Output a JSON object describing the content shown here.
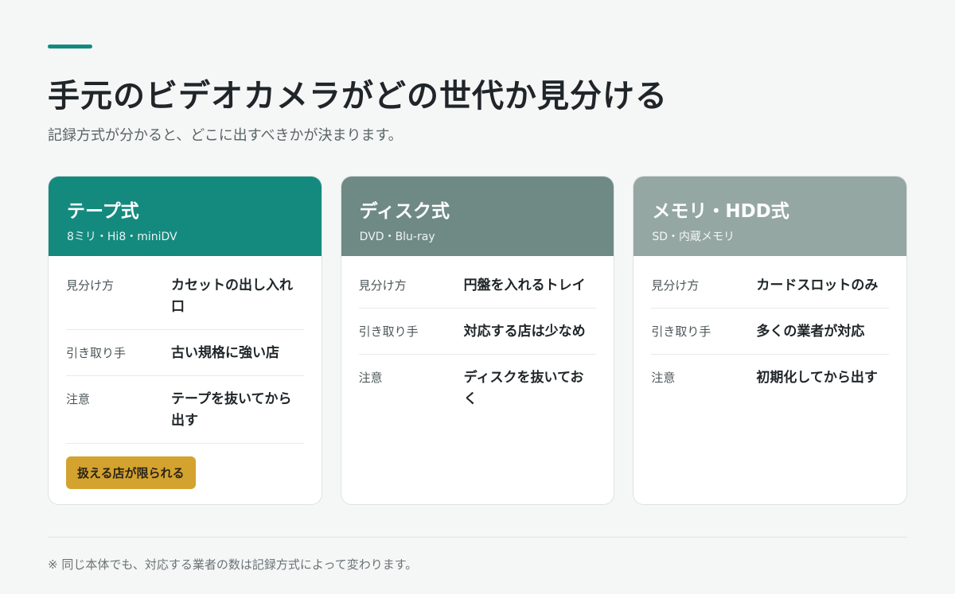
{
  "page": {
    "title": "手元のビデオカメラがどの世代か見分ける",
    "subtitle": "記録方式が分かると、どこに出すべきかが決まります。",
    "footnote": "※ 同じ本体でも、対応する業者の数は記録方式によって変わります。"
  },
  "colors": {
    "accent": "#148a7f",
    "tape_header": "#148a7f",
    "disc_header": "#6f8a85",
    "memory_header": "#95a7a3",
    "badge": "#d4a22e"
  },
  "cards": [
    {
      "title": "テープ式",
      "subtitle": "8ミリ・Hi8・miniDV",
      "rows": [
        {
          "label": "見分け方",
          "value": "カセットの出し入れ口"
        },
        {
          "label": "引き取り手",
          "value": "古い規格に強い店"
        },
        {
          "label": "注意",
          "value": "テープを抜いてから出す"
        }
      ],
      "badge": "扱える店が限られる"
    },
    {
      "title": "ディスク式",
      "subtitle": "DVD・Blu-ray",
      "rows": [
        {
          "label": "見分け方",
          "value": "円盤を入れるトレイ"
        },
        {
          "label": "引き取り手",
          "value": "対応する店は少なめ"
        },
        {
          "label": "注意",
          "value": "ディスクを抜いておく"
        }
      ]
    },
    {
      "title": "メモリ・HDD式",
      "subtitle": "SD・内蔵メモリ",
      "rows": [
        {
          "label": "見分け方",
          "value": "カードスロットのみ"
        },
        {
          "label": "引き取り手",
          "value": "多くの業者が対応"
        },
        {
          "label": "注意",
          "value": "初期化してから出す"
        }
      ]
    }
  ]
}
